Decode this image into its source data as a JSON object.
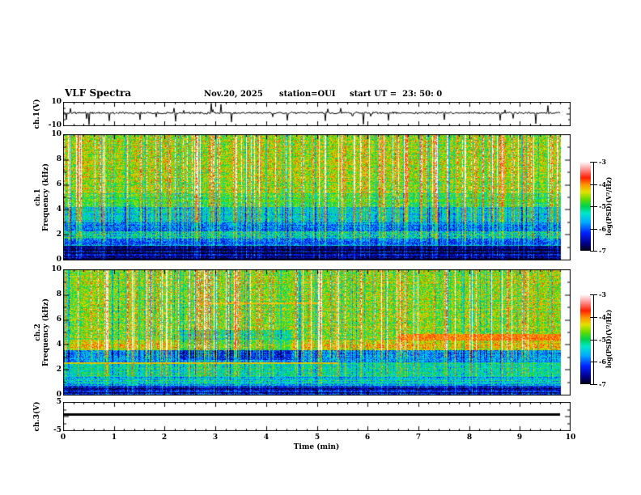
{
  "header": {
    "title": "VLF Spectra",
    "date": "Nov.20, 2025",
    "station": "station=OUI",
    "start_ut": "start UT =  23: 50: 0"
  },
  "xaxis": {
    "label": "Time (min)",
    "lim": [
      0,
      10
    ],
    "ticks": [
      "0",
      "1",
      "2",
      "3",
      "4",
      "5",
      "6",
      "7",
      "8",
      "9",
      "10"
    ],
    "minor_step": 0.2,
    "data_end_min": 9.8
  },
  "colorbar": {
    "label": "log(PSD)(V²/Hz)",
    "ticks": [
      "-3",
      "-4",
      "-5",
      "-6",
      "-7"
    ],
    "range": [
      -7,
      -3
    ],
    "colormap_stops": [
      [
        0.0,
        "#000010"
      ],
      [
        0.08,
        "#000085"
      ],
      [
        0.2,
        "#0020ff"
      ],
      [
        0.32,
        "#00aaff"
      ],
      [
        0.42,
        "#00e6c8"
      ],
      [
        0.5,
        "#00d24b"
      ],
      [
        0.58,
        "#64dc00"
      ],
      [
        0.66,
        "#e1e100"
      ],
      [
        0.74,
        "#ff9600"
      ],
      [
        0.82,
        "#ff1e00"
      ],
      [
        0.92,
        "#ff9b9b"
      ],
      [
        1.0,
        "#ffffff"
      ]
    ]
  },
  "chart_data": [
    {
      "type": "line",
      "name": "ch1-waveform",
      "ylabel": "ch.1(V)",
      "ylim": [
        -10,
        10
      ],
      "ytick_labels": [
        {
          "v": 10,
          "t": "10"
        },
        {
          "v": -10,
          "t": "-10"
        }
      ],
      "baseline": 1.0,
      "noise_std": 0.55,
      "seed": 11,
      "spikes": [
        {
          "x": 0.05,
          "v": -5
        },
        {
          "x": 0.12,
          "v": 5
        },
        {
          "x": 0.5,
          "v": -9.5
        },
        {
          "x": 0.9,
          "v": -6
        },
        {
          "x": 1.5,
          "v": -5
        },
        {
          "x": 2.2,
          "v": -6.5
        },
        {
          "x": 2.9,
          "v": 9.5
        },
        {
          "x": 3.1,
          "v": 8.5
        },
        {
          "x": 3.3,
          "v": -7
        },
        {
          "x": 4.4,
          "v": -5.5
        },
        {
          "x": 5.15,
          "v": -6
        },
        {
          "x": 5.9,
          "v": -9
        },
        {
          "x": 6.4,
          "v": -5.5
        },
        {
          "x": 7.5,
          "v": -5
        },
        {
          "x": 8.6,
          "v": -5.5
        },
        {
          "x": 9.3,
          "v": -8.5
        },
        {
          "x": 9.55,
          "v": 7.5
        }
      ]
    },
    {
      "type": "heatmap",
      "name": "ch1-spectrogram",
      "ylabel": "ch.1\nFrequency (kHz)",
      "ylim": [
        0,
        10
      ],
      "ytick_labels": [
        {
          "v": 10,
          "t": "10"
        },
        {
          "v": 8,
          "t": "8"
        },
        {
          "v": 6,
          "t": "6"
        },
        {
          "v": 4,
          "t": "4"
        },
        {
          "v": 2,
          "t": "2"
        },
        {
          "v": 0,
          "t": "0"
        }
      ],
      "value_range": [
        -7,
        -3
      ],
      "seed": 23,
      "bands": [
        {
          "f": [
            5.3,
            10
          ],
          "base": -4.5,
          "noise": 0.55
        },
        {
          "f": [
            4.2,
            5.3
          ],
          "base": -4.85,
          "noise": 0.5
        },
        {
          "f": [
            3.0,
            4.2
          ],
          "base": -5.45,
          "noise": 0.5
        },
        {
          "f": [
            2.25,
            3.0
          ],
          "base": -5.85,
          "noise": 0.5
        },
        {
          "f": [
            1.7,
            2.25
          ],
          "base": -5.35,
          "noise": 0.7
        },
        {
          "f": [
            1.1,
            1.7
          ],
          "base": -5.95,
          "noise": 0.5
        },
        {
          "f": [
            0.0,
            1.1
          ],
          "base": -6.55,
          "noise": 0.45
        }
      ],
      "streaks": {
        "prob": 0.2,
        "strength": 1.15,
        "neg_prob": 0.1,
        "neg_strength": 0.8
      },
      "features": [
        {
          "mode": "floor",
          "f": [
            4.6,
            4.78
          ],
          "x": [
            0,
            9.8
          ],
          "value": -4.9
        }
      ]
    },
    {
      "type": "heatmap",
      "name": "ch2-spectrogram",
      "ylabel": "ch.2\nFrequency (kHz)",
      "ylim": [
        0,
        10
      ],
      "ytick_labels": [
        {
          "v": 10,
          "t": "10"
        },
        {
          "v": 8,
          "t": "8"
        },
        {
          "v": 6,
          "t": "6"
        },
        {
          "v": 4,
          "t": "4"
        },
        {
          "v": 2,
          "t": "2"
        },
        {
          "v": 0,
          "t": "0"
        }
      ],
      "value_range": [
        -7,
        -3
      ],
      "seed": 37,
      "bands": [
        {
          "f": [
            4.4,
            10
          ],
          "base": -4.6,
          "noise": 0.55
        },
        {
          "f": [
            3.6,
            4.4
          ],
          "base": -4.25,
          "noise": 0.45
        },
        {
          "f": [
            2.6,
            3.6
          ],
          "base": -5.75,
          "noise": 0.5
        },
        {
          "f": [
            1.4,
            2.6
          ],
          "base": -5.2,
          "noise": 0.55
        },
        {
          "f": [
            0.7,
            1.4
          ],
          "base": -5.65,
          "noise": 0.5
        },
        {
          "f": [
            0.0,
            0.7
          ],
          "base": -6.3,
          "noise": 0.5
        }
      ],
      "streaks": {
        "prob": 0.17,
        "strength": 1.2,
        "neg_prob": 0.12,
        "neg_strength": 0.9
      },
      "features": [
        {
          "mode": "floor",
          "f": [
            4.35,
            4.85
          ],
          "x": [
            6.6,
            9.8
          ],
          "value": -4.0
        },
        {
          "mode": "floor",
          "f": [
            2.5,
            2.62
          ],
          "x": [
            0,
            5.4
          ],
          "value": -4.3
        },
        {
          "mode": "floor",
          "f": [
            7.25,
            7.4
          ],
          "x": [
            2.6,
            5.1
          ],
          "value": -4.2
        },
        {
          "mode": "add",
          "f": [
            2.8,
            5.2
          ],
          "x": [
            2.3,
            4.5
          ],
          "value": -0.45
        }
      ]
    },
    {
      "type": "line",
      "name": "ch3-waveform",
      "ylabel": "ch.3(V)",
      "ylim": [
        -5,
        5
      ],
      "ytick_labels": [
        {
          "v": 5,
          "t": "5"
        },
        {
          "v": -5,
          "t": "-5"
        }
      ],
      "constant_band": [
        0.2,
        1.3
      ],
      "seed": 5
    }
  ]
}
